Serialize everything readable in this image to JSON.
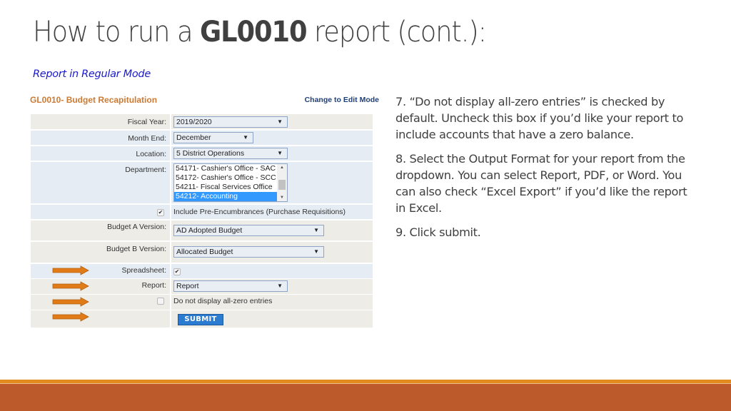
{
  "slide": {
    "title_before": "How to run a ",
    "title_bold": "GL0010",
    "title_after": " report (cont.):",
    "subtitle": "Report in Regular Mode"
  },
  "form": {
    "title": "GL0010- Budget Recapitulation",
    "edit_link": "Change to Edit Mode",
    "fiscal_year": {
      "label": "Fiscal Year:",
      "value": "2019/2020"
    },
    "month_end": {
      "label": "Month End:",
      "value": "December"
    },
    "location": {
      "label": "Location:",
      "value": "5 District Operations"
    },
    "department": {
      "label": "Department:",
      "options": [
        {
          "text": "54171- Cashier's Office - SAC",
          "selected": false
        },
        {
          "text": "54172- Cashier's Office - SCC",
          "selected": false
        },
        {
          "text": "54211- Fiscal Services Office",
          "selected": false
        },
        {
          "text": "54212- Accounting",
          "selected": true
        }
      ]
    },
    "pre_encumbrances": {
      "label": "Include Pre-Encumbrances (Purchase Requisitions)",
      "checked": true
    },
    "budget_a": {
      "label": "Budget A Version:",
      "value": "AD Adopted Budget"
    },
    "budget_b": {
      "label": "Budget B Version:",
      "value": "Allocated Budget"
    },
    "spreadsheet": {
      "label": "Spreadsheet:",
      "checked": true
    },
    "report": {
      "label": "Report:",
      "value": "Report"
    },
    "zero_entries": {
      "label": "Do not display all-zero entries",
      "checked": false
    },
    "submit_label": "SUBMIT",
    "check_glyph": "✔",
    "dropdown_glyph": "▼",
    "scroll_up_glyph": "▲",
    "scroll_down_glyph": "▼"
  },
  "colors": {
    "arrow": "#e07b17",
    "arrow_border": "#b55f10",
    "form_title": "#cc7a33",
    "footer_band": "#bd5a2c",
    "footer_top": "#e38a1f"
  },
  "instructions": [
    "7. “Do not display all-zero entries” is checked by default.  Uncheck this box if you’d like your report to include accounts that have a zero balance.",
    "8. Select the Output Format for your report from the dropdown.  You can select Report, PDF, or Word.  You can also check “Excel Export” if you’d like the report in Excel.",
    "9. Click submit."
  ]
}
